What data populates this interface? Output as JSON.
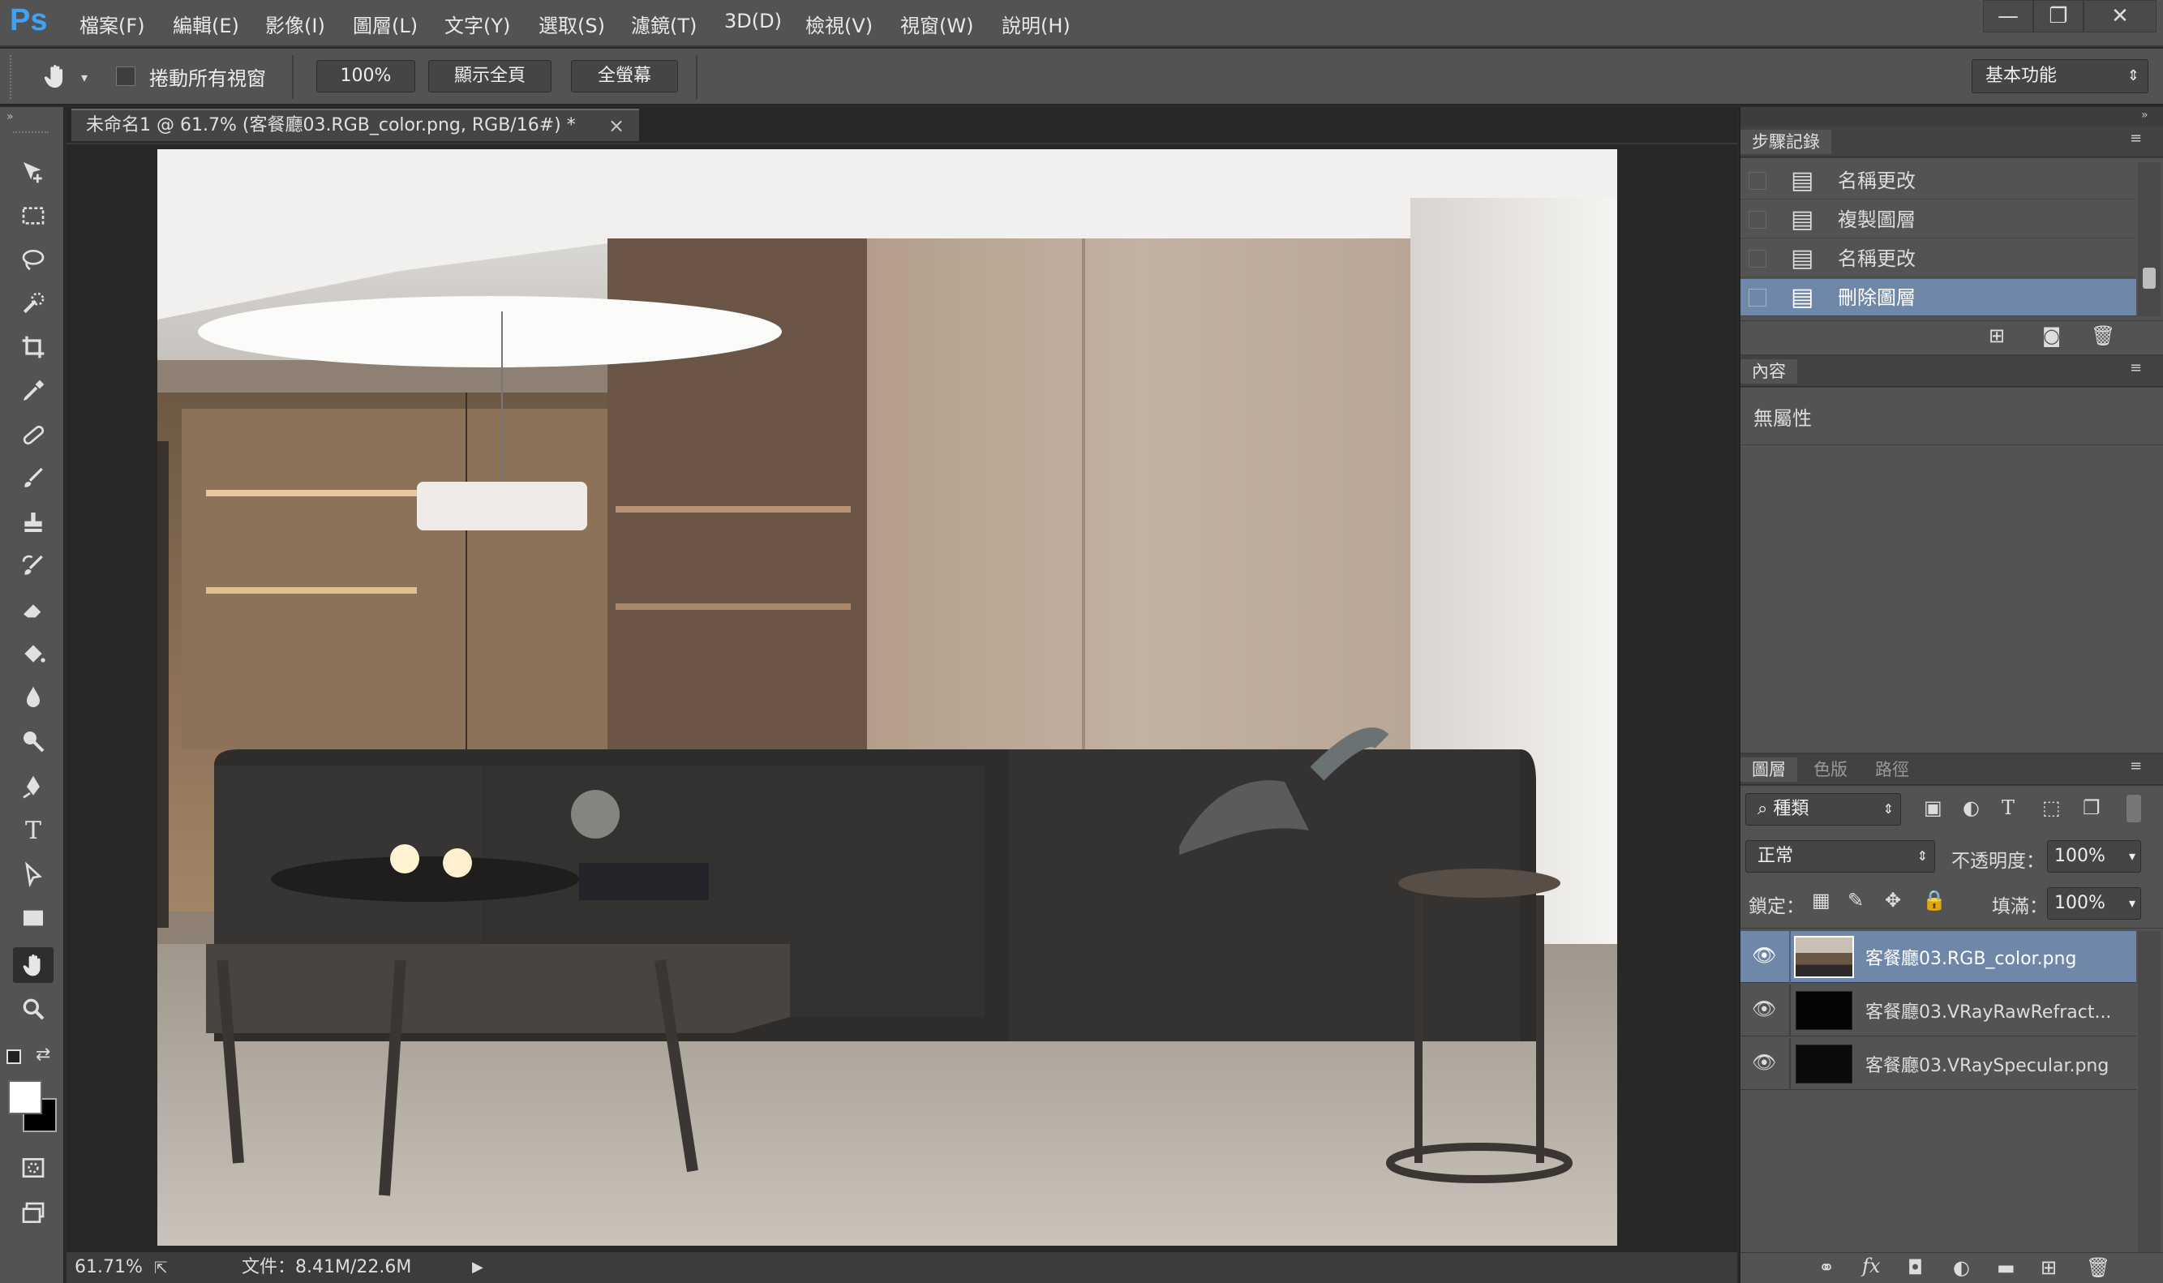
{
  "app": {
    "logo": "Ps"
  },
  "menu": [
    "檔案(F)",
    "編輯(E)",
    "影像(I)",
    "圖層(L)",
    "文字(Y)",
    "選取(S)",
    "濾鏡(T)",
    "3D(D)",
    "檢視(V)",
    "視窗(W)",
    "說明(H)"
  ],
  "window_controls": {
    "minimize": "—",
    "restore": "❐",
    "close": "✕"
  },
  "options": {
    "scroll_all_label": "捲動所有視窗",
    "btn_100": "100%",
    "btn_fit": "顯示全頁",
    "btn_fill": "全螢幕",
    "workspace": "基本功能"
  },
  "document": {
    "tab_title": "未命名1 @ 61.7% (客餐廳03.RGB_color.png, RGB/16#) *",
    "tab_close": "×"
  },
  "status": {
    "zoom": "61.71%",
    "doc_size": "文件：8.41M/22.6M"
  },
  "history": {
    "tab": "步驟記錄",
    "items": [
      "名稱更改",
      "複製圖層",
      "名稱更改",
      "刪除圖層"
    ],
    "selected_index": 3
  },
  "properties": {
    "tab": "內容",
    "text": "無屬性"
  },
  "layers_panel": {
    "tabs": [
      "圖層",
      "色版",
      "路徑"
    ],
    "filter_kind": "種類",
    "blend_mode": "正常",
    "opacity_label": "不透明度：",
    "opacity_value": "100%",
    "lock_label": "鎖定：",
    "fill_label": "填滿：",
    "fill_value": "100%",
    "layers": [
      {
        "name": "客餐廳03.RGB_color.png",
        "selected": true
      },
      {
        "name": "客餐廳03.VRayRawRefract...",
        "selected": false
      },
      {
        "name": "客餐廳03.VRaySpecular.png",
        "selected": false
      }
    ]
  },
  "colors": {
    "accent_selected": "#6f87a8",
    "panel_bg": "#535353"
  }
}
